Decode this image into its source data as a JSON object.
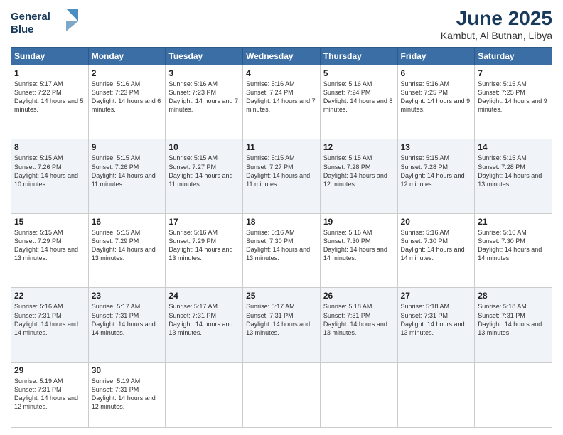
{
  "logo": {
    "line1": "General",
    "line2": "Blue"
  },
  "title": "June 2025",
  "subtitle": "Kambut, Al Butnan, Libya",
  "days_header": [
    "Sunday",
    "Monday",
    "Tuesday",
    "Wednesday",
    "Thursday",
    "Friday",
    "Saturday"
  ],
  "weeks": [
    [
      {
        "day": "1",
        "sunrise": "5:17 AM",
        "sunset": "7:22 PM",
        "daylight": "14 hours and 5 minutes."
      },
      {
        "day": "2",
        "sunrise": "5:16 AM",
        "sunset": "7:23 PM",
        "daylight": "14 hours and 6 minutes."
      },
      {
        "day": "3",
        "sunrise": "5:16 AM",
        "sunset": "7:23 PM",
        "daylight": "14 hours and 7 minutes."
      },
      {
        "day": "4",
        "sunrise": "5:16 AM",
        "sunset": "7:24 PM",
        "daylight": "14 hours and 7 minutes."
      },
      {
        "day": "5",
        "sunrise": "5:16 AM",
        "sunset": "7:24 PM",
        "daylight": "14 hours and 8 minutes."
      },
      {
        "day": "6",
        "sunrise": "5:16 AM",
        "sunset": "7:25 PM",
        "daylight": "14 hours and 9 minutes."
      },
      {
        "day": "7",
        "sunrise": "5:15 AM",
        "sunset": "7:25 PM",
        "daylight": "14 hours and 9 minutes."
      }
    ],
    [
      {
        "day": "8",
        "sunrise": "5:15 AM",
        "sunset": "7:26 PM",
        "daylight": "14 hours and 10 minutes."
      },
      {
        "day": "9",
        "sunrise": "5:15 AM",
        "sunset": "7:26 PM",
        "daylight": "14 hours and 11 minutes."
      },
      {
        "day": "10",
        "sunrise": "5:15 AM",
        "sunset": "7:27 PM",
        "daylight": "14 hours and 11 minutes."
      },
      {
        "day": "11",
        "sunrise": "5:15 AM",
        "sunset": "7:27 PM",
        "daylight": "14 hours and 11 minutes."
      },
      {
        "day": "12",
        "sunrise": "5:15 AM",
        "sunset": "7:28 PM",
        "daylight": "14 hours and 12 minutes."
      },
      {
        "day": "13",
        "sunrise": "5:15 AM",
        "sunset": "7:28 PM",
        "daylight": "14 hours and 12 minutes."
      },
      {
        "day": "14",
        "sunrise": "5:15 AM",
        "sunset": "7:28 PM",
        "daylight": "14 hours and 13 minutes."
      }
    ],
    [
      {
        "day": "15",
        "sunrise": "5:15 AM",
        "sunset": "7:29 PM",
        "daylight": "14 hours and 13 minutes."
      },
      {
        "day": "16",
        "sunrise": "5:15 AM",
        "sunset": "7:29 PM",
        "daylight": "14 hours and 13 minutes."
      },
      {
        "day": "17",
        "sunrise": "5:16 AM",
        "sunset": "7:29 PM",
        "daylight": "14 hours and 13 minutes."
      },
      {
        "day": "18",
        "sunrise": "5:16 AM",
        "sunset": "7:30 PM",
        "daylight": "14 hours and 13 minutes."
      },
      {
        "day": "19",
        "sunrise": "5:16 AM",
        "sunset": "7:30 PM",
        "daylight": "14 hours and 14 minutes."
      },
      {
        "day": "20",
        "sunrise": "5:16 AM",
        "sunset": "7:30 PM",
        "daylight": "14 hours and 14 minutes."
      },
      {
        "day": "21",
        "sunrise": "5:16 AM",
        "sunset": "7:30 PM",
        "daylight": "14 hours and 14 minutes."
      }
    ],
    [
      {
        "day": "22",
        "sunrise": "5:16 AM",
        "sunset": "7:31 PM",
        "daylight": "14 hours and 14 minutes."
      },
      {
        "day": "23",
        "sunrise": "5:17 AM",
        "sunset": "7:31 PM",
        "daylight": "14 hours and 14 minutes."
      },
      {
        "day": "24",
        "sunrise": "5:17 AM",
        "sunset": "7:31 PM",
        "daylight": "14 hours and 13 minutes."
      },
      {
        "day": "25",
        "sunrise": "5:17 AM",
        "sunset": "7:31 PM",
        "daylight": "14 hours and 13 minutes."
      },
      {
        "day": "26",
        "sunrise": "5:18 AM",
        "sunset": "7:31 PM",
        "daylight": "14 hours and 13 minutes."
      },
      {
        "day": "27",
        "sunrise": "5:18 AM",
        "sunset": "7:31 PM",
        "daylight": "14 hours and 13 minutes."
      },
      {
        "day": "28",
        "sunrise": "5:18 AM",
        "sunset": "7:31 PM",
        "daylight": "14 hours and 13 minutes."
      }
    ],
    [
      {
        "day": "29",
        "sunrise": "5:19 AM",
        "sunset": "7:31 PM",
        "daylight": "14 hours and 12 minutes."
      },
      {
        "day": "30",
        "sunrise": "5:19 AM",
        "sunset": "7:31 PM",
        "daylight": "14 hours and 12 minutes."
      },
      null,
      null,
      null,
      null,
      null
    ]
  ],
  "labels": {
    "sunrise": "Sunrise:",
    "sunset": "Sunset:",
    "daylight": "Daylight:"
  }
}
